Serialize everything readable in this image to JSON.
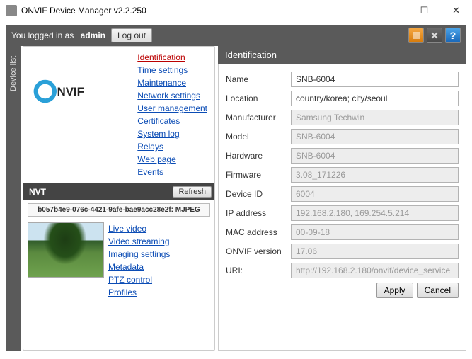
{
  "window": {
    "title": "ONVIF Device Manager v2.2.250",
    "min": "—",
    "max": "☐",
    "close": "✕"
  },
  "topbar": {
    "prefix": "You logged in as",
    "user": "admin",
    "logout": "Log out",
    "help_glyph": "?"
  },
  "sidetab": {
    "device_list": "Device list"
  },
  "nav": {
    "identification": "Identification",
    "time_settings": "Time settings",
    "maintenance": "Maintenance",
    "network_settings": "Network settings",
    "user_management": "User management",
    "certificates": "Certificates",
    "system_log": "System log",
    "relays": "Relays",
    "web_page": "Web page",
    "events": "Events"
  },
  "nvt": {
    "label": "NVT",
    "refresh": "Refresh",
    "device_id": "b057b4e9-076c-4421-9afe-bae9acc28e2f: MJPEG"
  },
  "streamlinks": {
    "live_video": "Live video",
    "video_streaming": "Video streaming",
    "imaging_settings": "Imaging settings",
    "metadata": "Metadata",
    "ptz_control": "PTZ control",
    "profiles": "Profiles"
  },
  "panel": {
    "header": "Identification",
    "apply": "Apply",
    "cancel": "Cancel"
  },
  "fields": {
    "name": {
      "label": "Name",
      "value": "SNB-6004",
      "readonly": false
    },
    "location": {
      "label": "Location",
      "value": "country/korea; city/seoul",
      "readonly": false
    },
    "manufacturer": {
      "label": "Manufacturer",
      "value": "Samsung Techwin",
      "readonly": true
    },
    "model": {
      "label": "Model",
      "value": "SNB-6004",
      "readonly": true
    },
    "hardware": {
      "label": "Hardware",
      "value": "SNB-6004",
      "readonly": true
    },
    "firmware": {
      "label": "Firmware",
      "value": "3.08_171226",
      "readonly": true
    },
    "device_id": {
      "label": "Device ID",
      "value": "6004",
      "readonly": true
    },
    "ip_address": {
      "label": "IP address",
      "value": "192.168.2.180, 169.254.5.214",
      "readonly": true
    },
    "mac_address": {
      "label": "MAC address",
      "value": "00-09-18",
      "readonly": true
    },
    "onvif_version": {
      "label": "ONVIF version",
      "value": "17.06",
      "readonly": true
    },
    "uri": {
      "label": "URI:",
      "value": "http://192.168.2.180/onvif/device_service",
      "readonly": true
    }
  }
}
